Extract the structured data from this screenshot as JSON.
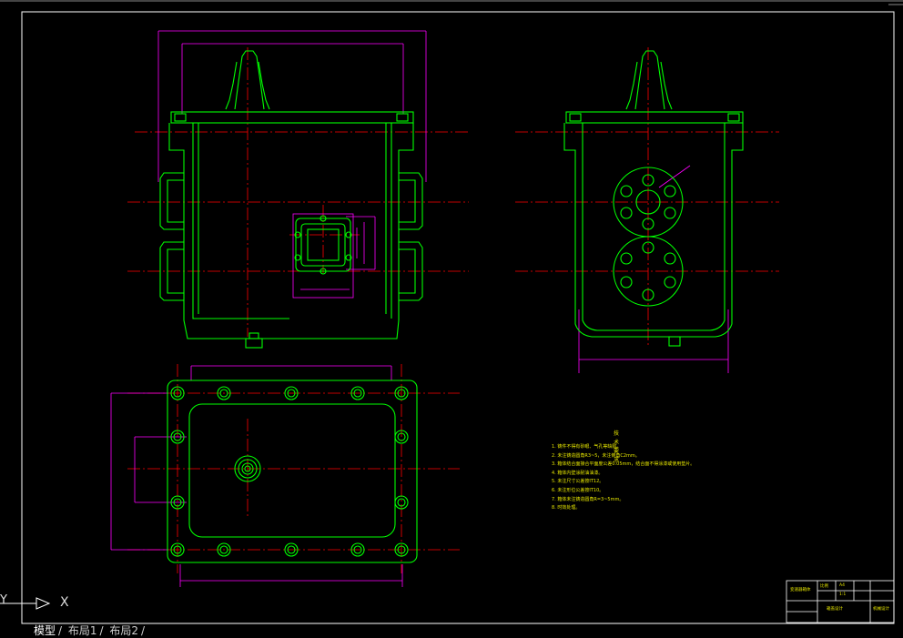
{
  "window": {
    "background": "#000000"
  },
  "colors": {
    "outline": "#00ff00",
    "center": "#ff0000",
    "dim": "#ff00ff",
    "text": "#ffff00",
    "frame": "#ffffff"
  },
  "ucs": {
    "x_label": "X",
    "y_label": "Y"
  },
  "layout_tabs": [
    {
      "label": "模型",
      "active": true
    },
    {
      "label": "布局1",
      "active": false
    },
    {
      "label": "布局2",
      "active": false
    }
  ],
  "notes": {
    "title": "技术要求",
    "items": [
      "1. 铸件不得有砂眼、气孔等缺陷。",
      "2. 未注铸造圆角R3~5，未注倒角C2mm。",
      "3. 箱体结合面接合平面度公差0.05mm，结合面不得涂漆或使用垫片。",
      "4. 箱体内壁涂耐油油漆。",
      "5. 未注尺寸公差按IT12。",
      "6. 未注形位公差按IT10。",
      "7. 箱体未注铸造圆角R=3~5mm。",
      "8. 时效处理。"
    ]
  },
  "title_block": {
    "name": "变速器箱体",
    "drawing": "箱盖设计",
    "scale_label": "比例",
    "scale": "1:1",
    "sheet": "A4",
    "school": "机械设计"
  }
}
